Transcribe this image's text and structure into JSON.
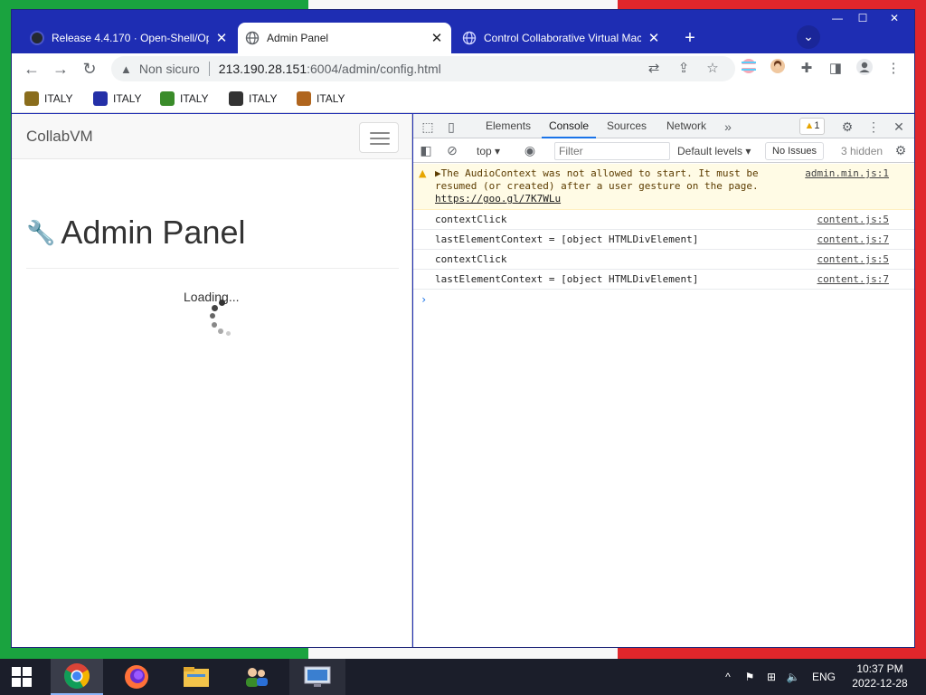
{
  "browser": {
    "tabs": [
      {
        "title": "Release 4.4.170 · Open-Shell/Ope",
        "active": false
      },
      {
        "title": "Admin Panel",
        "active": true
      },
      {
        "title": "Control Collaborative Virtual Mach",
        "active": false
      }
    ],
    "new_tab": "+",
    "tab_search": "⌄",
    "window_controls": {
      "minimize": "—",
      "maximize": "☐",
      "close": "✕"
    },
    "address": {
      "security_label": "Non sicuro",
      "host": "213.190.28.151",
      "path": ":6004/admin/config.html"
    },
    "bookmarks": [
      {
        "label": "ITALY",
        "color": "#8a6d1d"
      },
      {
        "label": "ITALY",
        "color": "#2430a8"
      },
      {
        "label": "ITALY",
        "color": "#3a8c2a"
      },
      {
        "label": "ITALY",
        "color": "#333333"
      },
      {
        "label": "ITALY",
        "color": "#b0651e"
      }
    ]
  },
  "page": {
    "brand": "CollabVM",
    "heading": "Admin Panel",
    "loading_text": "Loading..."
  },
  "devtools": {
    "tabs": [
      "Elements",
      "Console",
      "Sources",
      "Network"
    ],
    "active_tab": "Console",
    "more_tabs": "»",
    "warning_count": "1",
    "filter_bar": {
      "context": "top",
      "filter_placeholder": "Filter",
      "levels": "Default levels",
      "issues": "No Issues",
      "hidden": "3 hidden"
    },
    "messages": [
      {
        "type": "warning",
        "text": "▶The AudioContext was not allowed to start. It must be resumed (or created) after a user gesture on the page.",
        "link": "https://goo.gl/7K7WLu",
        "source": "admin.min.js:1"
      },
      {
        "type": "log",
        "text": "contextClick",
        "source": "content.js:5"
      },
      {
        "type": "log",
        "text": "lastElementContext = [object HTMLDivElement]",
        "source": "content.js:7"
      },
      {
        "type": "log",
        "text": "contextClick",
        "source": "content.js:5"
      },
      {
        "type": "log",
        "text": "lastElementContext = [object HTMLDivElement]",
        "source": "content.js:7"
      }
    ],
    "prompt": "›"
  },
  "taskbar": {
    "apps": [
      "chrome",
      "firefox",
      "file-explorer",
      "network-users",
      "remote-desktop"
    ],
    "active_app": "chrome",
    "tray": {
      "chevron": "^",
      "language": "ENG",
      "time": "10:37 PM",
      "date": "2022-12-28"
    }
  },
  "colors": {
    "titlebar": "#1e2db3",
    "flag_green": "#1aa33f",
    "flag_white": "#f7f7f7",
    "flag_red": "#e0262b",
    "devtools_accent": "#1a73e8",
    "warning_bg": "#fffbe5"
  }
}
